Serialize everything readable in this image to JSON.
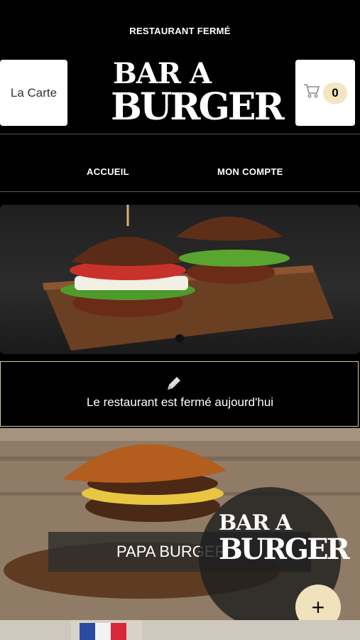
{
  "status_text": "RESTAURANT FERMÉ",
  "header": {
    "menu_button_label": "La Carte",
    "logo_line1": "BAR A",
    "logo_line2": "BURGER",
    "cart_count": "0"
  },
  "nav": {
    "home": "ACCUEIL",
    "account": "MON COMPTE"
  },
  "notice": {
    "text": "Le restaurant est fermé aujourd'hui"
  },
  "promo": {
    "product_label": "PAPA BURGER",
    "watermark_line1": "BAR A",
    "watermark_line2": "BURGER",
    "add_symbol": "+"
  },
  "colors": {
    "background": "#000000",
    "accent": "#f0e2bd",
    "border": "#d8c8a0"
  }
}
